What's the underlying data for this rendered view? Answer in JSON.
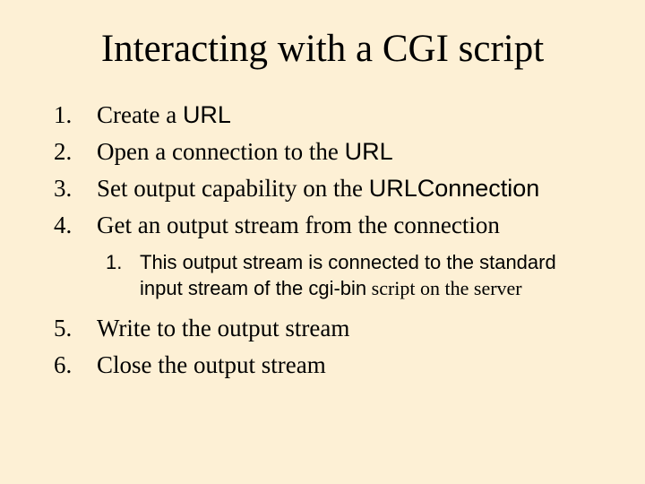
{
  "title": "Interacting with a CGI script",
  "items": [
    {
      "prefix": "Create a ",
      "code": "URL",
      "suffix": ""
    },
    {
      "prefix": "Open a connection to the ",
      "code": "URL",
      "suffix": ""
    },
    {
      "prefix": "Set output capability on the ",
      "code": "URLConnection",
      "suffix": ""
    },
    {
      "prefix": "Get an output stream from the connection",
      "code": "",
      "suffix": ""
    },
    {
      "prefix": "Write to the output stream",
      "code": "",
      "suffix": ""
    },
    {
      "prefix": "Close the output stream",
      "code": "",
      "suffix": ""
    }
  ],
  "sub_after_index": 3,
  "sub": [
    {
      "prefix": "This output stream is connected to the standard input stream of the ",
      "code": "cgi-bin",
      "suffix": " script on the server"
    }
  ]
}
